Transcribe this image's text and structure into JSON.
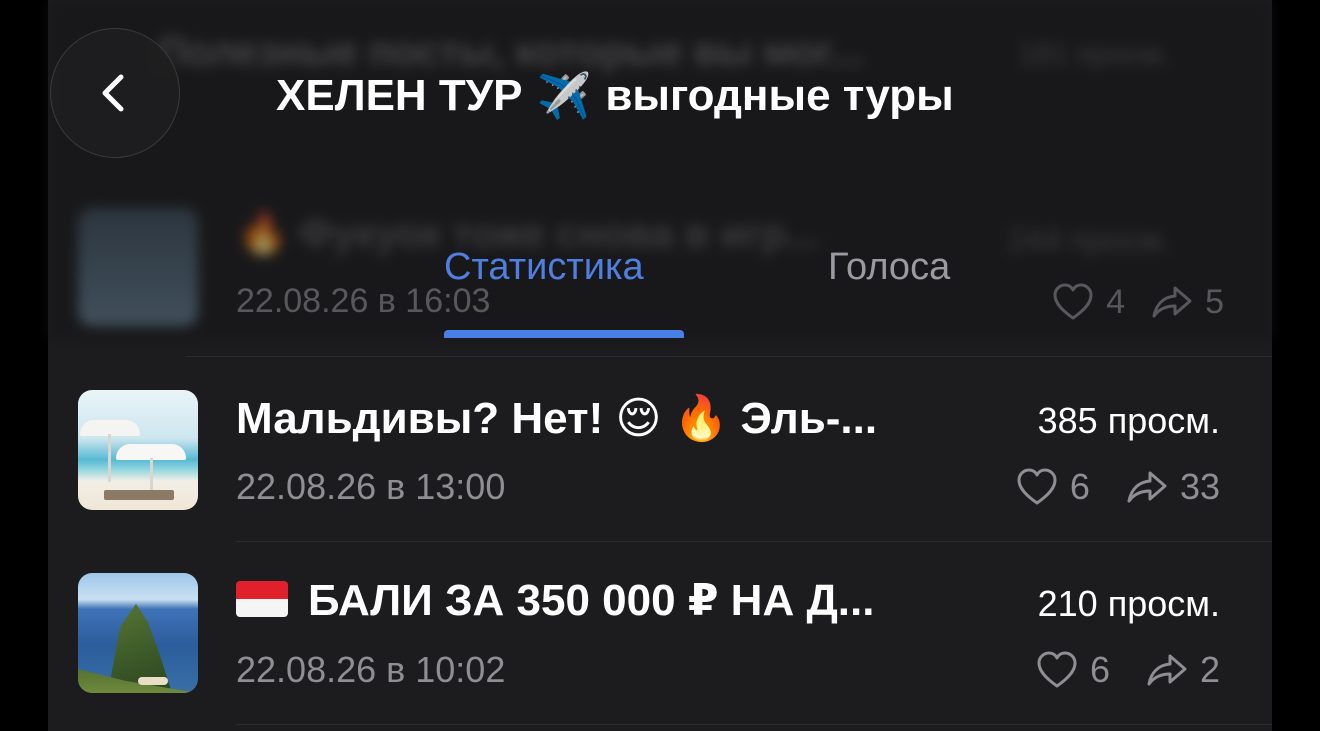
{
  "header": {
    "title_part1": "ХЕЛЕН ТУР",
    "title_emoji": "✈️",
    "title_part2": "выгодные туры",
    "back_icon": "chevron-left-icon"
  },
  "backdrop": {
    "ghost_title": "Полезные посты, которые вы мог...",
    "ghost_views1": "181 просм.",
    "ghost_row2_title": "🔥 Фукуок тоже снова в игр...",
    "ghost_row2_views": "244 просм.",
    "ghost_row2_date": "22.08.26 в 16:03",
    "ghost_row2_likes": "4",
    "ghost_row2_shares": "5"
  },
  "tabs": [
    {
      "label": "Статистика",
      "active": true
    },
    {
      "label": "Голоса",
      "active": false
    }
  ],
  "posts": [
    {
      "title": "Мальдивы? Нет! 😌 🔥 Эль-...",
      "views": "385 просм.",
      "date": "22.08.26 в 13:00",
      "likes": "6",
      "shares": "33"
    },
    {
      "flag": "indonesia-flag",
      "title": "БАЛИ ЗА 350 000 ₽ НА Д...",
      "views": "210 просм.",
      "date": "22.08.26 в 10:02",
      "likes": "6",
      "shares": "2"
    }
  ],
  "colors": {
    "accent": "#4a7fe6",
    "background": "#1c1c1e",
    "secondary_text": "#8e8e93"
  }
}
